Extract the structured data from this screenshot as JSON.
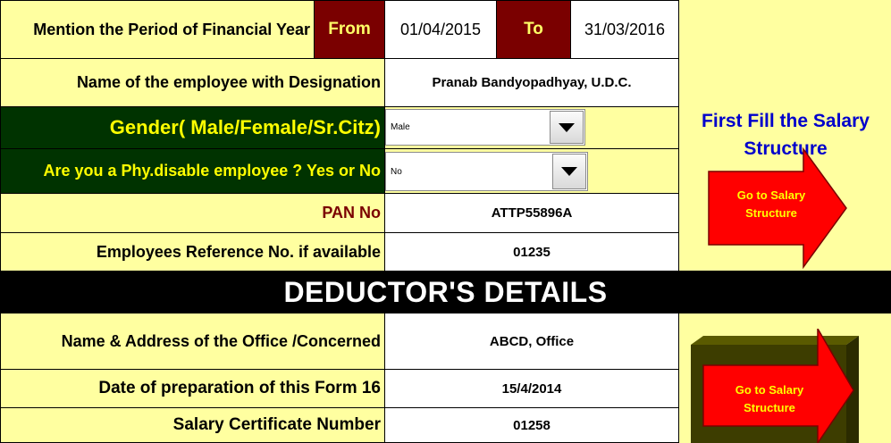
{
  "period": {
    "label": "Mention the Period of Financial Year",
    "from_label": "From",
    "from_value": "01/04/2015",
    "to_label": "To",
    "to_value": "31/03/2016"
  },
  "employee": {
    "name_label": "Name of the employee with Designation",
    "name_value": "Pranab Bandyopadhyay, U.D.C.",
    "gender_label": "Gender( Male/Female/Sr.Citz)",
    "gender_value": "Male",
    "disable_label": "Are you a Phy.disable employee ? Yes or No",
    "disable_value": "No",
    "pan_label": "PAN No",
    "pan_value": "ATTP55896A",
    "ref_label": "Employees Reference No. if available",
    "ref_value": "01235"
  },
  "deductor": {
    "heading": "DEDUCTOR'S DETAILS",
    "office_label": "Name  & Address of the Office /Concerned",
    "office_value": "ABCD, Office",
    "date_label": "Date of preparation of this Form 16",
    "date_value": "15/4/2014",
    "cert_label": "Salary Certificate Number",
    "cert_value": "01258"
  },
  "side": {
    "title_line1": "First Fill the Salary",
    "title_line2": "Structure",
    "button1_line1": "Go to Salary",
    "button1_line2": "Structure",
    "button2_line1": "Go to Salary",
    "button2_line2": "Structure"
  },
  "colors": {
    "sheet_bg": "#ffffa0",
    "maroon": "#7a0000",
    "dark_green": "#003300",
    "arrow_red": "#ff0000",
    "title_blue": "#0000cc"
  },
  "icons": [
    "dropdown-arrow-icon",
    "right-arrow-shape"
  ]
}
